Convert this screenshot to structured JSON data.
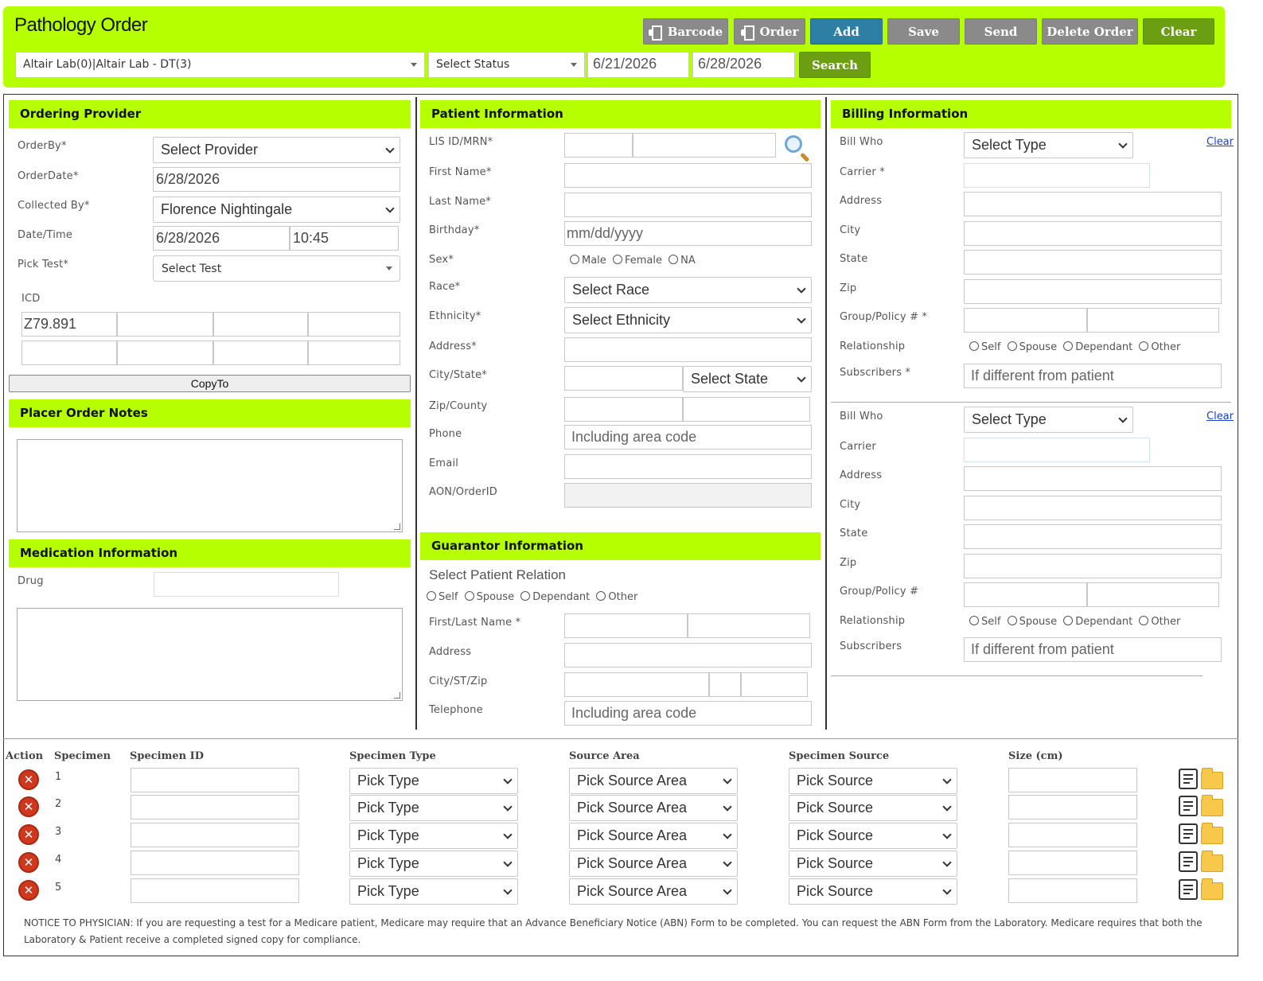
{
  "header": {
    "title": "Pathology Order",
    "buttons": {
      "barcode": "Barcode",
      "order": "Order",
      "add": "Add",
      "save": "Save",
      "send": "Send",
      "delete_order": "Delete Order",
      "clear": "Clear",
      "search": "Search"
    },
    "lab_select": "Altair Lab(0)|Altair Lab - DT(3)",
    "status_select": "Select Status",
    "date_from": "6/21/2026",
    "date_to": "6/28/2026"
  },
  "ordering_provider": {
    "title": "Ordering Provider",
    "order_by_label": "OrderBy*",
    "order_by_value": "Select Provider",
    "order_date_label": "OrderDate*",
    "order_date_value": "6/28/2026",
    "collected_by_label": "Collected By*",
    "collected_by_value": "Florence Nightingale",
    "datetime_label": "Date/Time",
    "date_value": "6/28/2026",
    "time_value": "10:45",
    "pick_test_label": "Pick Test*",
    "pick_test_value": "Select Test",
    "icd_label": "ICD",
    "icd_first": "Z79.891",
    "copyto": "CopyTo"
  },
  "placer_notes": {
    "title": "Placer Order Notes"
  },
  "medication": {
    "title": "Medication Information",
    "drug_label": "Drug"
  },
  "patient": {
    "title": "Patient Information",
    "lis_label": "LIS ID/MRN*",
    "first_name_label": "First Name*",
    "last_name_label": "Last Name*",
    "birthday_label": "Birthday*",
    "birthday_placeholder": "mm/dd/yyyy",
    "sex_label": "Sex*",
    "sex_options": [
      "Male",
      "Female",
      "NA"
    ],
    "race_label": "Race*",
    "race_value": "Select Race",
    "ethnicity_label": "Ethnicity*",
    "ethnicity_value": "Select Ethnicity",
    "address_label": "Address*",
    "city_state_label": "City/State*",
    "state_value": "Select State",
    "zip_label": "Zip/County",
    "phone_label": "Phone",
    "phone_placeholder": "Including area code",
    "email_label": "Email",
    "aon_label": "AON/OrderID"
  },
  "guarantor": {
    "title": "Guarantor Information",
    "relation_heading": "Select Patient Relation",
    "relation_options": [
      "Self",
      "Spouse",
      "Dependant",
      "Other"
    ],
    "name_label": "First/Last Name *",
    "address_label": "Address",
    "city_label": "City/ST/Zip",
    "telephone_label": "Telephone",
    "telephone_placeholder": "Including area code"
  },
  "billing": {
    "title": "Billing Information",
    "primary": {
      "bill_who_label": "Bill Who",
      "bill_who_value": "Select Type",
      "clear": "Clear",
      "carrier_label": "Carrier *",
      "address_label": "Address",
      "city_label": "City",
      "state_label": "State",
      "zip_label": "Zip",
      "group_label": "Group/Policy # *",
      "relationship_label": "Relationship",
      "relationship_options": [
        "Self",
        "Spouse",
        "Dependant",
        "Other"
      ],
      "subscribers_label": "Subscribers *",
      "subscribers_placeholder": "If different from patient"
    },
    "secondary": {
      "bill_who_label": "Bill Who",
      "bill_who_value": "Select Type",
      "clear": "Clear",
      "carrier_label": "Carrier",
      "address_label": "Address",
      "city_label": "City",
      "state_label": "State",
      "zip_label": "Zip",
      "group_label": "Group/Policy #",
      "relationship_label": "Relationship",
      "relationship_options": [
        "Self",
        "Spouse",
        "Dependant",
        "Other"
      ],
      "subscribers_label": "Subscribers",
      "subscribers_placeholder": "If different from patient"
    }
  },
  "specimens": {
    "headers": {
      "action": "Action",
      "specimen": "Specimen",
      "specimen_id": "Specimen ID",
      "type": "Specimen Type",
      "source_area": "Source Area",
      "source": "Specimen Source",
      "size": "Size (cm)"
    },
    "rows": [
      {
        "n": "1",
        "type": "Pick Type",
        "area": "Pick Source Area",
        "source": "Pick Source"
      },
      {
        "n": "2",
        "type": "Pick Type",
        "area": "Pick Source Area",
        "source": "Pick Source"
      },
      {
        "n": "3",
        "type": "Pick Type",
        "area": "Pick Source Area",
        "source": "Pick Source"
      },
      {
        "n": "4",
        "type": "Pick Type",
        "area": "Pick Source Area",
        "source": "Pick Source"
      },
      {
        "n": "5",
        "type": "Pick Type",
        "area": "Pick Source Area",
        "source": "Pick Source"
      }
    ]
  },
  "notice": "NOTICE TO PHYSICIAN: If you are requesting a test for a Medicare patient, Medicare may require that an Advance Beneficiary Notice (ABN) Form to be completed. You can request the ABN Form from the Laboratory. Medicare requires that both the Laboratory & Patient receive a completed signed copy for compliance."
}
